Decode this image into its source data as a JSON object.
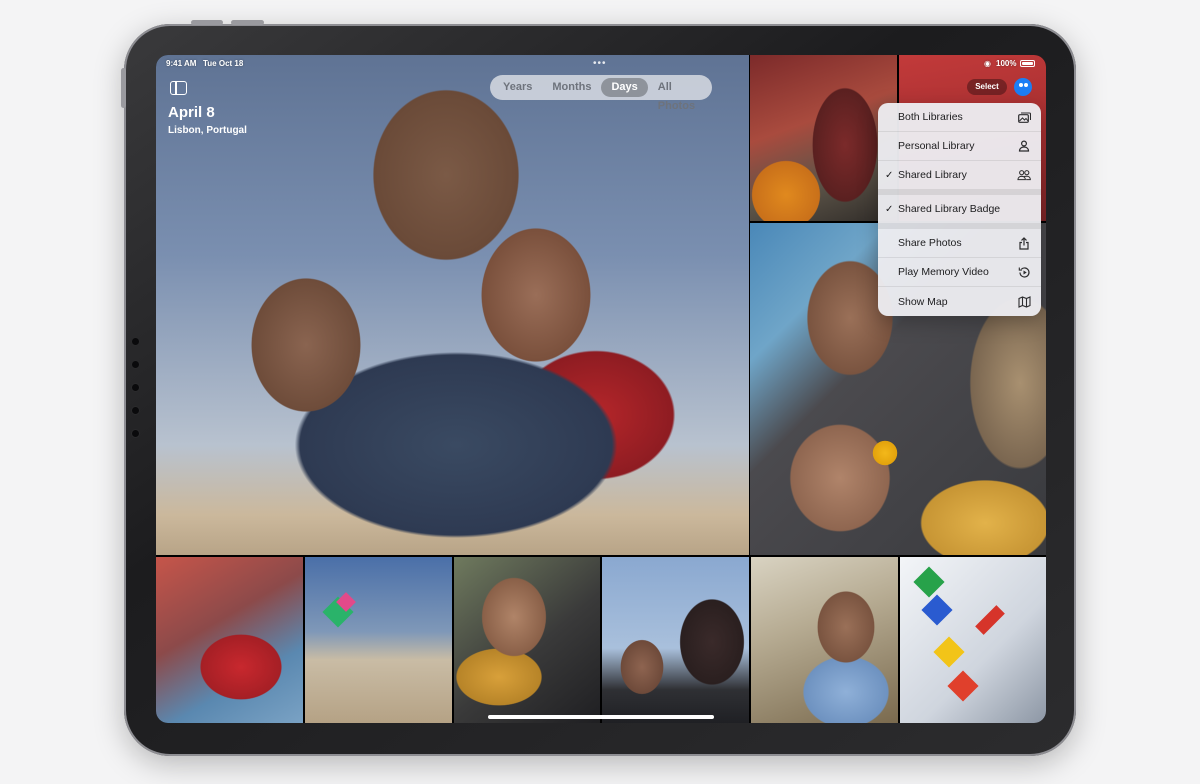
{
  "status_bar": {
    "time": "9:41 AM",
    "date": "Tue Oct 18",
    "battery": "100%"
  },
  "header": {
    "title": "April 8",
    "location": "Lisbon, Portugal"
  },
  "view_tabs": [
    {
      "label": "Years",
      "active": false
    },
    {
      "label": "Months",
      "active": false
    },
    {
      "label": "Days",
      "active": true
    },
    {
      "label": "All Photos",
      "active": false
    }
  ],
  "toolbar": {
    "select_label": "Select"
  },
  "menu": {
    "items": [
      {
        "label": "Both Libraries",
        "checked": false,
        "icon": "photo-stack-icon"
      },
      {
        "label": "Personal Library",
        "checked": false,
        "icon": "person-icon"
      },
      {
        "label": "Shared Library",
        "checked": true,
        "icon": "two-people-icon"
      },
      {
        "label": "Shared Library Badge",
        "checked": true,
        "icon": ""
      },
      {
        "label": "Share Photos",
        "checked": false,
        "icon": "share-icon"
      },
      {
        "label": "Play Memory Video",
        "checked": false,
        "icon": "play-memory-icon"
      },
      {
        "label": "Show Map",
        "checked": false,
        "icon": "map-icon"
      }
    ],
    "check_glyph": "✓"
  },
  "colors": {
    "accent": "#1c7ef5",
    "segment_active": "#8e939b"
  }
}
